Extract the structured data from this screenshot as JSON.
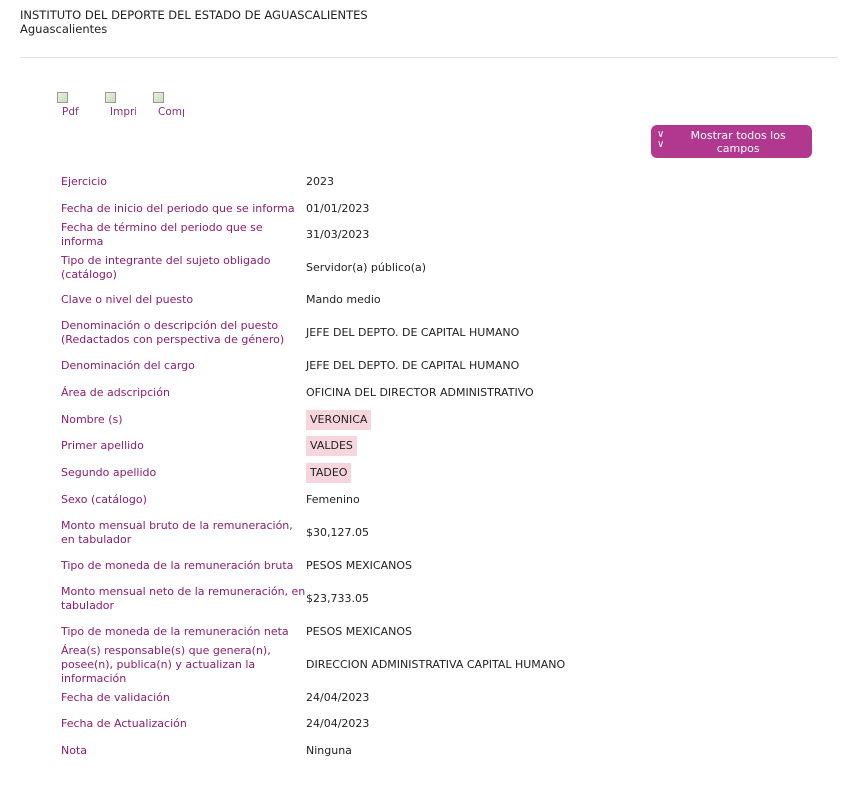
{
  "header": {
    "institution": "INSTITUTO DEL DEPORTE DEL ESTADO DE AGUASCALIENTES",
    "location": "Aguascalientes"
  },
  "export": {
    "items": [
      {
        "label": "Pdf"
      },
      {
        "label": "Impri"
      },
      {
        "label": "Comp"
      }
    ]
  },
  "actions": {
    "show_all_label": "Mostrar todos los campos"
  },
  "fields": [
    {
      "label": "Ejercicio",
      "value": "2023"
    },
    {
      "label": "Fecha de inicio del periodo que se informa",
      "value": "01/01/2023"
    },
    {
      "label": "Fecha de término del periodo que se informa",
      "value": "31/03/2023"
    },
    {
      "label": "Tipo de integrante del sujeto obligado (catálogo)",
      "value": "Servidor(a) público(a)"
    },
    {
      "label": "Clave o nivel del puesto",
      "value": "Mando medio"
    },
    {
      "label": "Denominación o descripción del puesto (Redactados con perspectiva de género)",
      "value": "JEFE DEL DEPTO. DE CAPITAL HUMANO"
    },
    {
      "label": "Denominación del cargo",
      "value": "JEFE DEL DEPTO. DE CAPITAL HUMANO"
    },
    {
      "label": "Área de adscripción",
      "value": "OFICINA DEL DIRECTOR ADMINISTRATIVO"
    },
    {
      "label": "Nombre (s)",
      "value": "VERONICA"
    },
    {
      "label": "Primer apellido",
      "value": "VALDES"
    },
    {
      "label": "Segundo apellido",
      "value": "TADEO"
    },
    {
      "label": "Sexo (catálogo)",
      "value": "Femenino"
    },
    {
      "label": "Monto mensual bruto de la remuneración, en tabulador",
      "value": "$30,127.05"
    },
    {
      "label": "Tipo de moneda de la remuneración bruta",
      "value": "PESOS MEXICANOS"
    },
    {
      "label": "Monto mensual neto de la remuneración, en tabulador",
      "value": "$23,733.05"
    },
    {
      "label": "Tipo de moneda de la remuneración neta",
      "value": "PESOS MEXICANOS"
    },
    {
      "label": "Área(s) responsable(s) que genera(n), posee(n), publica(n) y actualizan la información",
      "value": "DIRECCION ADMINISTRATIVA CAPITAL HUMANO"
    },
    {
      "label": "Fecha de validación",
      "value": "24/04/2023"
    },
    {
      "label": "Fecha de Actualización",
      "value": "24/04/2023"
    },
    {
      "label": "Nota",
      "value": "Ninguna"
    }
  ],
  "colors": {
    "accent": "#b2388f",
    "label": "#8a1d6f",
    "highlight": "#f6d6dc"
  }
}
